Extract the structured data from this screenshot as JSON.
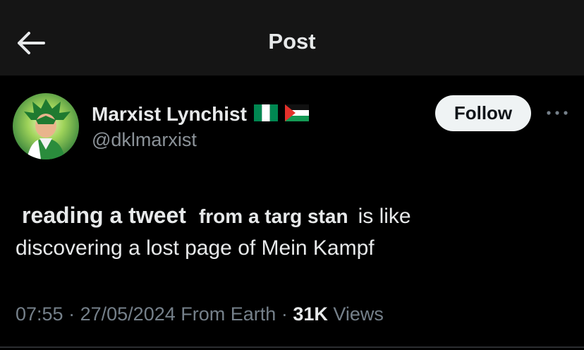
{
  "header": {
    "back_icon": "arrow-left-icon",
    "title": "Post"
  },
  "author": {
    "display_name": "Marxist Lynchist",
    "handle": "@dklmarxist",
    "flags": [
      "nigeria-flag-icon",
      "palestine-flag-icon"
    ],
    "follow_label": "Follow",
    "more_icon": "more-horizontal-icon"
  },
  "tweet": {
    "bold_part_1": "reading a tweet",
    "bold_part_2": "from a targ stan",
    "text_part_1": "is like",
    "text_part_2": "discovering a lost page of Mein Kampf"
  },
  "meta": {
    "time": "07:55",
    "separator": "·",
    "date": "27/05/2024",
    "source": "From Earth",
    "views_count": "31K",
    "views_label": "Views"
  },
  "colors": {
    "background": "#000000",
    "header_background": "#151515",
    "text": "#e7e9ea",
    "secondary_text": "#75808a",
    "follow_button": "#eff3f4"
  }
}
